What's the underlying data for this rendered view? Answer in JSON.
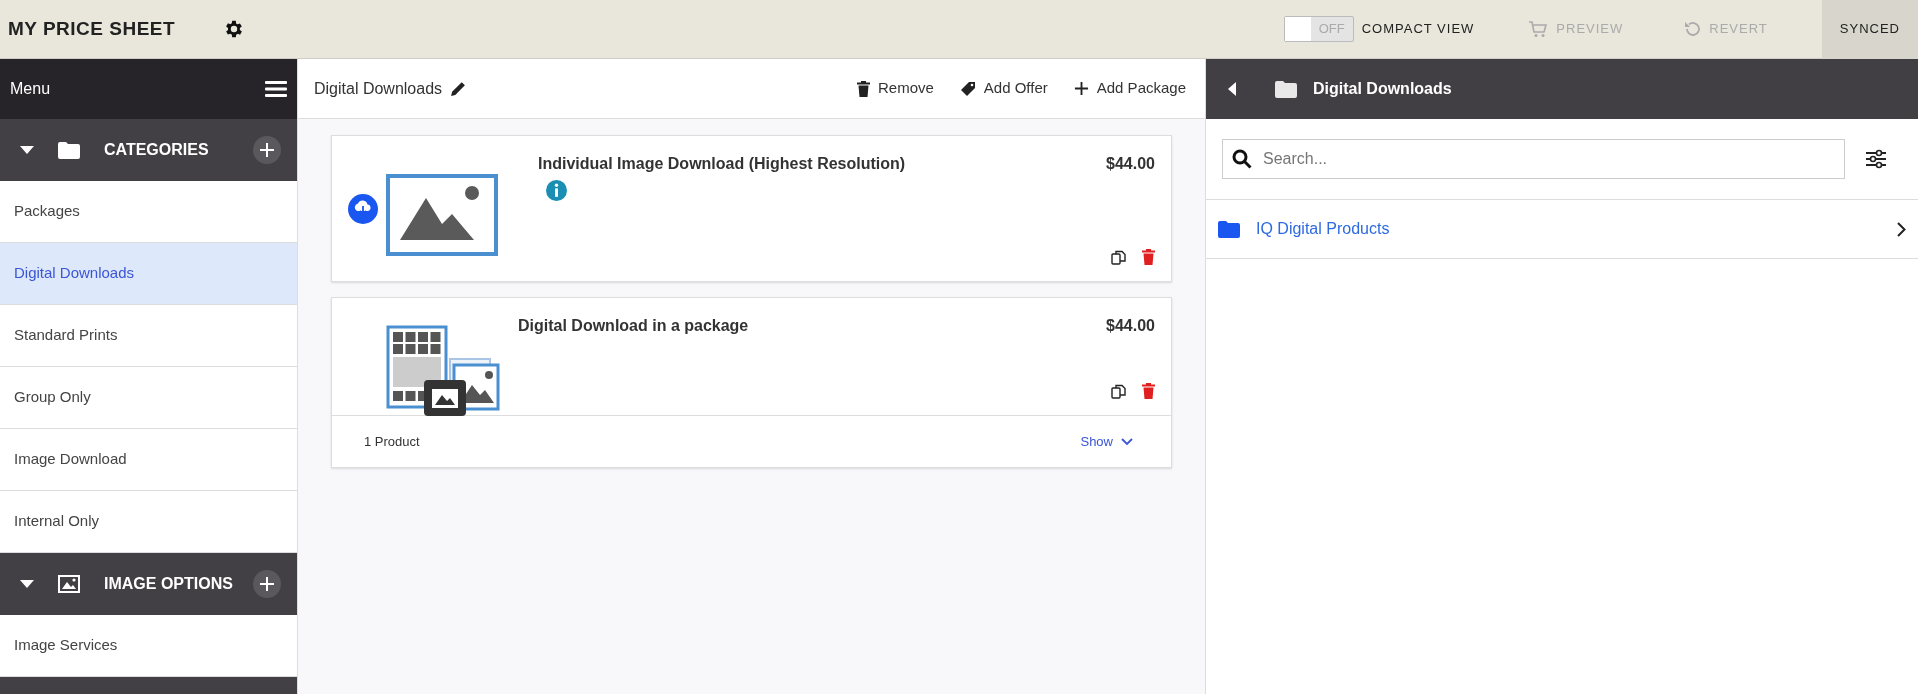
{
  "app": {
    "title": "MY PRICE SHEET"
  },
  "toolbar": {
    "compact_view": {
      "label": "COMPACT VIEW",
      "toggle_text": "OFF",
      "on": false
    },
    "actions": [
      {
        "label": "PREVIEW",
        "kind": "preview",
        "disabled": true
      },
      {
        "label": "REVERT",
        "kind": "revert",
        "disabled": true
      }
    ],
    "sync_status": "SYNCED"
  },
  "sidebar": {
    "title": "Menu",
    "sections": [
      {
        "title": "CATEGORIES",
        "kind": "folder",
        "expanded": true,
        "items": [
          {
            "label": "Packages",
            "selected": false
          },
          {
            "label": "Digital Downloads",
            "selected": true
          },
          {
            "label": "Standard Prints",
            "selected": false
          },
          {
            "label": "Group Only",
            "selected": false
          },
          {
            "label": "Image Download",
            "selected": false
          },
          {
            "label": "Internal Only",
            "selected": false
          }
        ]
      },
      {
        "title": "IMAGE OPTIONS",
        "kind": "image",
        "expanded": true,
        "items": [
          {
            "label": "Image Services",
            "selected": false
          }
        ]
      }
    ]
  },
  "main": {
    "title": "Digital Downloads",
    "actions": [
      {
        "label": "Remove",
        "kind": "remove"
      },
      {
        "label": "Add Offer",
        "kind": "offer"
      },
      {
        "label": "Add Package",
        "kind": "add"
      }
    ],
    "products": [
      {
        "name": "Individual Image Download (Highest Resolution)",
        "price": "$44.00",
        "kind": "image",
        "download_badge": true,
        "info": true
      },
      {
        "name": "Digital Download in a package",
        "price": "$44.00",
        "kind": "package",
        "download_badge": false,
        "info": false,
        "footer": {
          "count": "1 Product",
          "toggle": "Show"
        }
      }
    ]
  },
  "browser": {
    "title": "Digital Downloads",
    "search": {
      "placeholder": "Search..."
    },
    "folders": [
      {
        "label": "IQ Digital Products"
      }
    ]
  }
}
